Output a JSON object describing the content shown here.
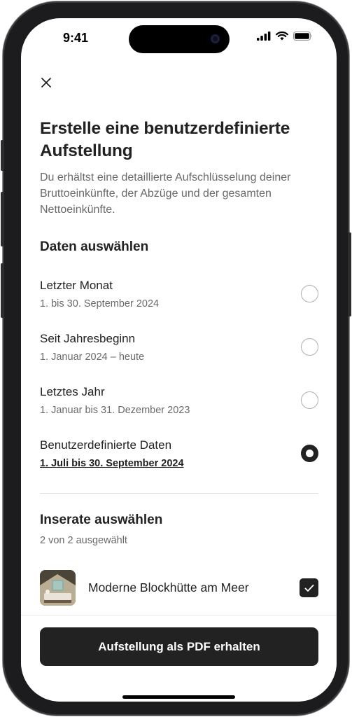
{
  "status_bar": {
    "time": "9:41"
  },
  "header": {
    "close_icon": "close-icon",
    "title": "Erstelle eine benutzerdefinierte Aufstellung",
    "subtitle": "Du erhältst eine detaillierte Aufschlüsselung deiner Bruttoeinkünfte, der Abzüge und der gesamten Nettoeinkünfte."
  },
  "dates": {
    "section_title": "Daten auswählen",
    "options": [
      {
        "label": "Letzter Monat",
        "sub": "1. bis 30. September 2024",
        "selected": false
      },
      {
        "label": "Seit Jahresbeginn",
        "sub": "1. Januar 2024 – heute",
        "selected": false
      },
      {
        "label": "Letztes Jahr",
        "sub": "1. Januar bis 31. Dezember 2023",
        "selected": false
      },
      {
        "label": "Benutzerdefinierte Daten",
        "sub": "1. Juli bis 30. September 2024",
        "selected": true
      }
    ]
  },
  "listings": {
    "section_title": "Inserate auswählen",
    "count_text": "2 von 2 ausgewählt",
    "items": [
      {
        "name": "Moderne Blockhütte am Meer",
        "checked": true
      }
    ]
  },
  "footer": {
    "cta_label": "Aufstellung als PDF erhalten"
  },
  "colors": {
    "primary": "#222222",
    "secondary_text": "#6a6a6a",
    "divider": "#dddddd",
    "background": "#ffffff"
  }
}
